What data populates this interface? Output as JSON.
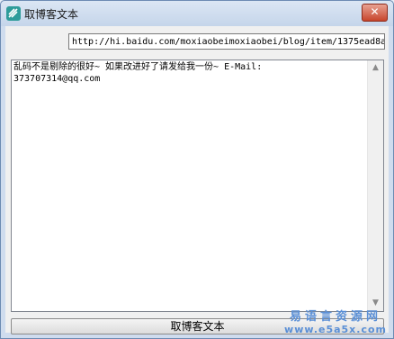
{
  "window": {
    "title": "取博客文本",
    "close_glyph": "✕"
  },
  "url_field": {
    "value": "http://hi.baidu.com/moxiaobeimoxiaobei/blog/item/1375ead8a"
  },
  "text_area": {
    "content": "乱码不是剔除的很好~ 如果改进好了请发给我一份~ E-Mail:\n373707314@qq.com"
  },
  "scrollbar": {
    "up_glyph": "▲",
    "down_glyph": "▼"
  },
  "fetch_button": {
    "label": "取博客文本"
  },
  "watermark": {
    "cn": "易语言资源网",
    "en": "www.e5a5x.com"
  }
}
